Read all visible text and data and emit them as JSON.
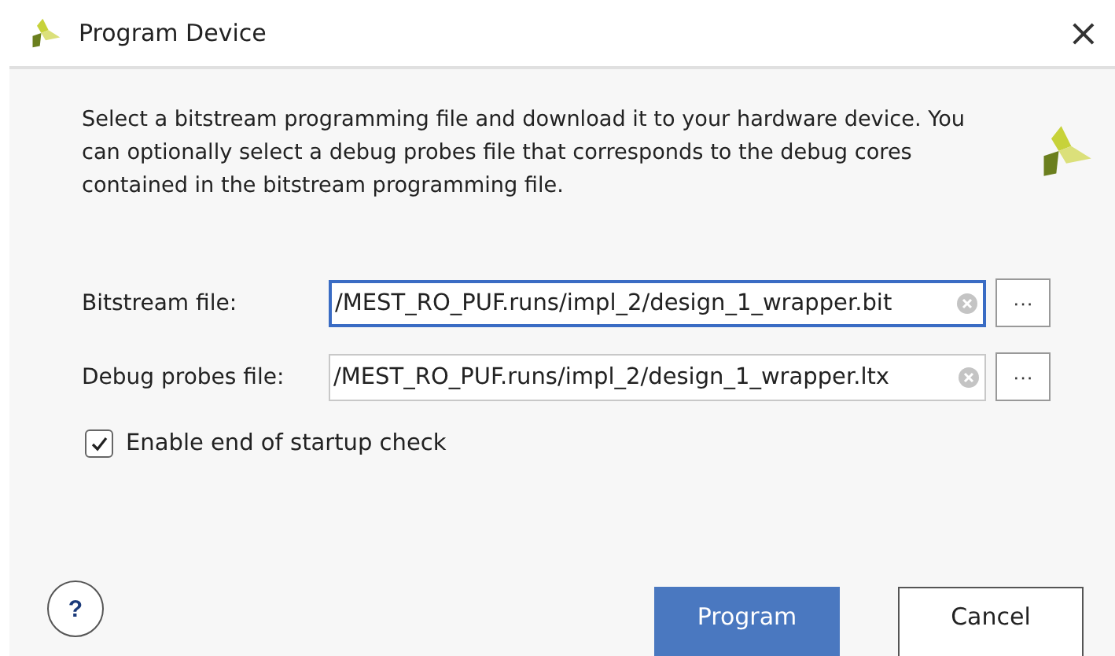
{
  "window": {
    "title": "Program Device",
    "close": "×"
  },
  "description": "Select a bitstream programming file and download it to your hardware device. You can optionally select a debug probes file that corresponds to the debug cores contained in the bitstream programming file.",
  "fields": [
    {
      "label": "Bitstream file:",
      "value": "/MEST_RO_PUF.runs/impl_2/design_1_wrapper.bit",
      "focused": true,
      "browse": "···"
    },
    {
      "label": "Debug probes file:",
      "value": "/MEST_RO_PUF.runs/impl_2/design_1_wrapper.ltx",
      "focused": false,
      "browse": "···"
    }
  ],
  "checkbox": {
    "label": "Enable end of startup check",
    "checked": true
  },
  "help": "?",
  "buttons": [
    {
      "label": "Program",
      "primary": true
    },
    {
      "label": "Cancel",
      "primary": false
    }
  ]
}
